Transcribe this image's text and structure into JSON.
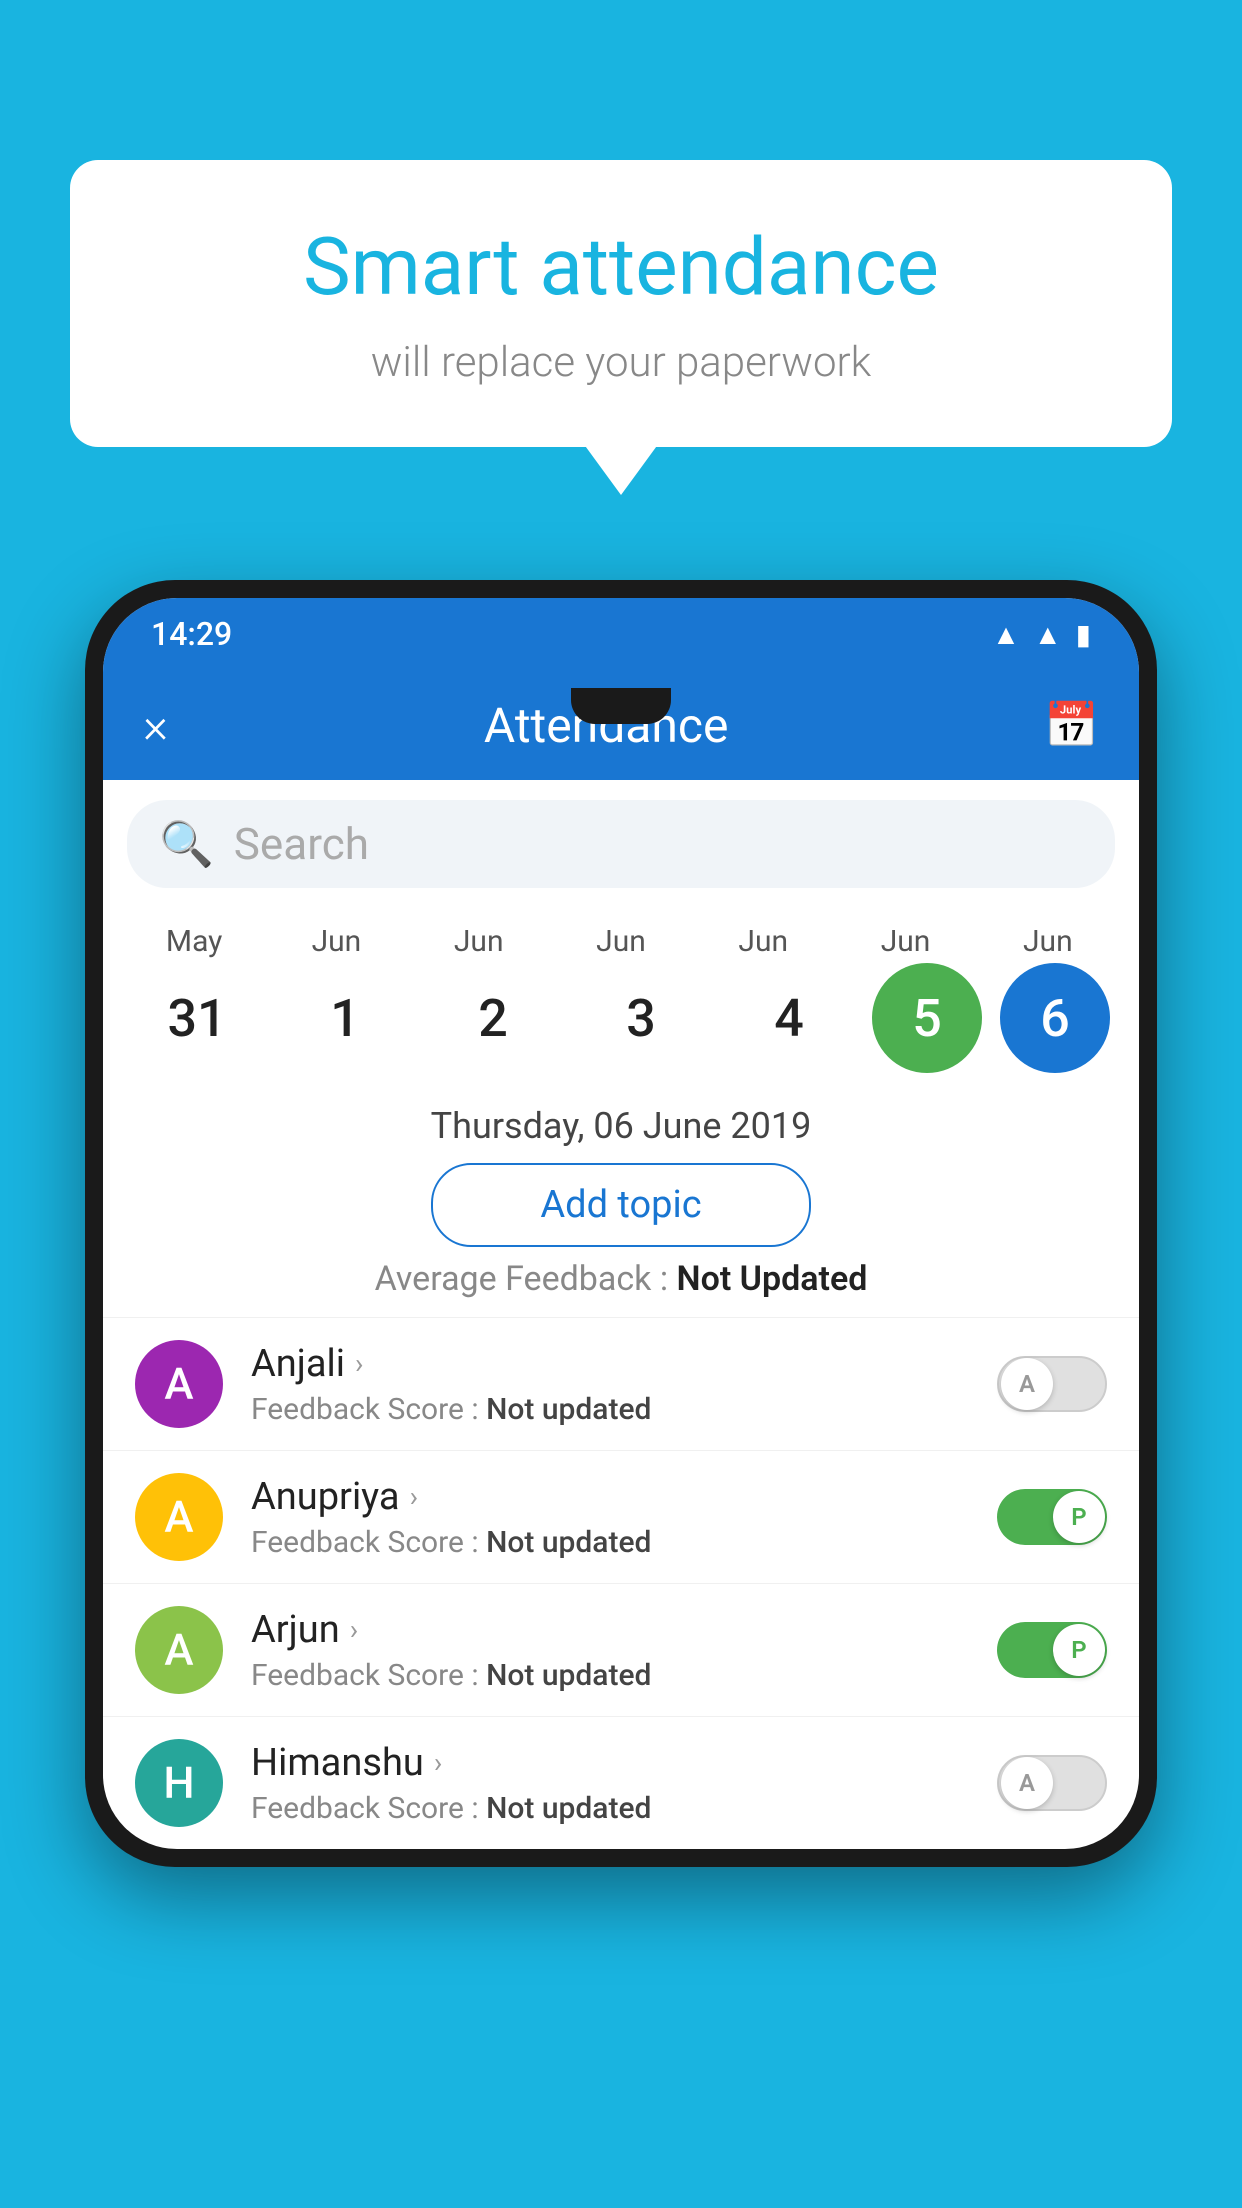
{
  "background_color": "#19b4e0",
  "speech_bubble": {
    "title": "Smart attendance",
    "subtitle": "will replace your paperwork"
  },
  "phone": {
    "status_bar": {
      "time": "14:29",
      "icons": [
        "wifi",
        "signal",
        "battery"
      ]
    },
    "app_bar": {
      "title": "Attendance",
      "close_label": "×",
      "calendar_icon": "📅"
    },
    "search": {
      "placeholder": "Search"
    },
    "calendar": {
      "months": [
        "May",
        "Jun",
        "Jun",
        "Jun",
        "Jun",
        "Jun",
        "Jun"
      ],
      "dates": [
        "31",
        "1",
        "2",
        "3",
        "4",
        "5",
        "6"
      ],
      "selected_green": "5",
      "selected_blue": "6"
    },
    "date_label": "Thursday, 06 June 2019",
    "add_topic_label": "Add topic",
    "average_feedback": {
      "label": "Average Feedback : ",
      "value": "Not Updated"
    },
    "students": [
      {
        "name": "Anjali",
        "avatar_letter": "A",
        "avatar_color": "avatar-purple",
        "feedback_label": "Feedback Score : ",
        "feedback_value": "Not updated",
        "toggle_state": "off",
        "toggle_label": "A"
      },
      {
        "name": "Anupriya",
        "avatar_letter": "A",
        "avatar_color": "avatar-yellow",
        "feedback_label": "Feedback Score : ",
        "feedback_value": "Not updated",
        "toggle_state": "on",
        "toggle_label": "P"
      },
      {
        "name": "Arjun",
        "avatar_letter": "A",
        "avatar_color": "avatar-light-green",
        "feedback_label": "Feedback Score : ",
        "feedback_value": "Not updated",
        "toggle_state": "on",
        "toggle_label": "P"
      },
      {
        "name": "Himanshu",
        "avatar_letter": "H",
        "avatar_color": "avatar-teal",
        "feedback_label": "Feedback Score : ",
        "feedback_value": "Not updated",
        "toggle_state": "off",
        "toggle_label": "A"
      }
    ]
  }
}
